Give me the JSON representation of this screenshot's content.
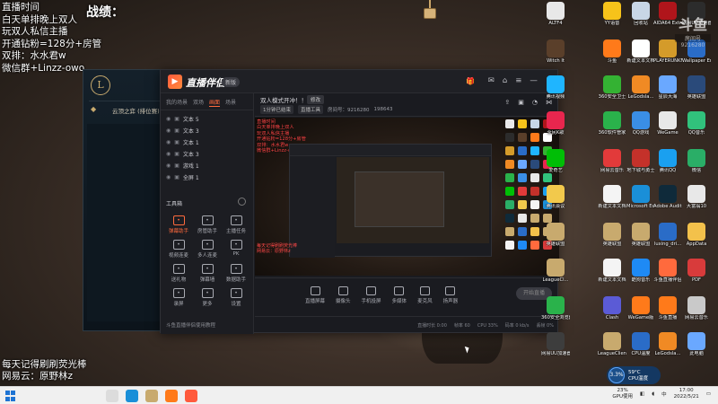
{
  "overlay": {
    "lines": [
      "直播时间",
      "白天单排晚上双人",
      "玩双人私信主播",
      "开通钻粉=128分+房管",
      "双排：水水君w",
      "微信群+Linzz-owo"
    ],
    "score_label": "战绩：",
    "bottom_lines": [
      "每天记得刷刷荧光棒",
      "网易云：原野林z"
    ]
  },
  "game_client": {
    "row_title": "云顶之弈 (排位赛)"
  },
  "app": {
    "name": "直播伴侣",
    "version_badge": "新版",
    "sidebar_tabs": [
      "我的场景",
      "双场",
      "画面",
      "场景"
    ],
    "sources": [
      "文本 5",
      "文本 3",
      "文本 1",
      "文本 3",
      "游戏 1",
      "全屏 1"
    ],
    "tools_title": "工具箱",
    "tools": [
      {
        "label": "弹幕助手",
        "icon": "danmu-icon",
        "hot": true
      },
      {
        "label": "房管助手",
        "icon": "manager-icon",
        "hot": false
      },
      {
        "label": "主播任务",
        "icon": "task-icon",
        "hot": false
      },
      {
        "label": "视频连麦",
        "icon": "video-link-icon",
        "hot": false
      },
      {
        "label": "多人连麦",
        "icon": "multi-link-icon",
        "hot": false
      },
      {
        "label": "PK",
        "icon": "pk-icon",
        "hot": false
      },
      {
        "label": "送礼物",
        "icon": "gift-icon",
        "hot": false
      },
      {
        "label": "弹幕墙",
        "icon": "wall-icon",
        "hot": false
      },
      {
        "label": "数据助手",
        "icon": "data-icon",
        "hot": false
      },
      {
        "label": "录屏",
        "icon": "record-icon",
        "hot": false
      },
      {
        "label": "更多",
        "icon": "more-icon",
        "hot": false
      },
      {
        "label": "设置",
        "icon": "settings-icon",
        "hot": false
      }
    ],
    "side_footer": "斗鱼直播伴侣使用教程",
    "room_title": "双人模式开冲！！",
    "room_button": "修改",
    "room_sub": [
      "1分钟已结束",
      "直播工具",
      "房间号：9216280",
      "198643"
    ],
    "preview_overlay": [
      "直播时间",
      "白天单排晚上双人",
      "玩双人私信主播",
      "开通钻粉=128分+房管",
      "双排：水水君w",
      "微信群+Linzz-owo"
    ],
    "preview_bottom": [
      "每天记得刷刷荧光棒",
      "网易云：原野林z"
    ],
    "controls": [
      {
        "label": "直播屏幕",
        "icon": "screen-icon"
      },
      {
        "label": "摄像头",
        "icon": "camera-icon"
      },
      {
        "label": "手机投屏",
        "icon": "phone-cast-icon"
      },
      {
        "label": "多媒体",
        "icon": "media-icon"
      },
      {
        "label": "麦克风",
        "icon": "mic-icon"
      },
      {
        "label": "扬声器",
        "icon": "speaker-icon"
      }
    ],
    "start_button": "开始直播",
    "status": [
      "直播时长 0:00",
      "帧率 60",
      "CPU 33%",
      "码率 0 kb/s",
      "丢帧 0%"
    ]
  },
  "desktop_icons": [
    {
      "label": "ALTF4",
      "color": "#e8e8e8"
    },
    {
      "label": "YY语音",
      "color": "#f7c31a"
    },
    {
      "label": "回收站",
      "color": "#c8d6e6"
    },
    {
      "label": "AIDA64 Extreme",
      "color": "#b0151b"
    },
    {
      "label": "网易UU加速器",
      "color": "#2c2c2c"
    },
    {
      "label": "Witch It",
      "color": "#5a3f2a"
    },
    {
      "label": "斗鱼",
      "color": "#ff7a1a"
    },
    {
      "label": "新建文本文档",
      "color": "#ffffff"
    },
    {
      "label": "PLAYERUNKNOWN'S BATTLEGROUNDS",
      "color": "#d49b2a"
    },
    {
      "label": "Wallpaper Engine",
      "color": "#2a6cc7"
    },
    {
      "label": "腾讯视频",
      "color": "#1fb5ff"
    },
    {
      "label": "360安全卫士",
      "color": "#34b233"
    },
    {
      "label": "LeGodsla...",
      "color": "#f08a24"
    },
    {
      "label": "星辰大海",
      "color": "#6aa8ff"
    },
    {
      "label": "英雄联盟",
      "color": "#2a4a7a"
    },
    {
      "label": "全民K歌",
      "color": "#e8264e"
    },
    {
      "label": "360软件管家",
      "color": "#2ab24b"
    },
    {
      "label": "QQ游戏",
      "color": "#3a8ee6"
    },
    {
      "label": "WeGame",
      "color": "#e8e8e8"
    },
    {
      "label": "QQ音乐",
      "color": "#31c27c"
    },
    {
      "label": "爱奇艺",
      "color": "#00be06"
    },
    {
      "label": "网易云音乐",
      "color": "#e23a3a"
    },
    {
      "label": "地下城与勇士",
      "color": "#c4312a"
    },
    {
      "label": "腾讯QQ",
      "color": "#1aa0f0"
    },
    {
      "label": "微信",
      "color": "#2aae67"
    },
    {
      "label": "腾讯会议",
      "color": "#f2c94c"
    },
    {
      "label": "新建文本文档",
      "color": "#f4f4f4"
    },
    {
      "label": "Microsoft Edge",
      "color": "#1a8fd8"
    },
    {
      "label": "Adobe Audition",
      "color": "#0f2a3a"
    },
    {
      "label": "大富翁10",
      "color": "#e8e8e8"
    },
    {
      "label": "英雄联盟",
      "color": "#c8aa6e"
    },
    {
      "label": "英雄联盟",
      "color": "#c8aa6e"
    },
    {
      "label": "英雄联盟",
      "color": "#c8aa6e"
    },
    {
      "label": "luxing_dri...",
      "color": "#2a6cc7"
    },
    {
      "label": "AppData",
      "color": "#f3c14b"
    },
    {
      "label": "LeagueCl...",
      "color": "#c8aa6e"
    },
    {
      "label": "新建文本文档",
      "color": "#f4f4f4"
    },
    {
      "label": "酷狗音乐",
      "color": "#1e8af5"
    },
    {
      "label": "斗鱼直播伴侣",
      "color": "#ff6a3d"
    },
    {
      "label": "PDF",
      "color": "#d83b3b"
    },
    {
      "label": "360安全浏览器",
      "color": "#2ab24b"
    },
    {
      "label": "Clash",
      "color": "#5b5bd6"
    },
    {
      "label": "WeGame版",
      "color": "#ff7a1a"
    },
    {
      "label": "斗鱼直播",
      "color": "#ff7a1a"
    },
    {
      "label": "网易云音乐",
      "color": "#c9c9c9"
    },
    {
      "label": "网易UU加速器",
      "color": "#3d3d3d"
    },
    {
      "label": "LeagueClient",
      "color": "#c8aa6e"
    },
    {
      "label": "CPU温度",
      "color": "#2a6cc7"
    },
    {
      "label": "LeGodsla...",
      "color": "#f08a24"
    },
    {
      "label": "此电脑",
      "color": "#6aa8ff"
    }
  ],
  "watermark": {
    "logo": "斗鱼",
    "sub": "房间号",
    "num": "9216280"
  },
  "cpu_widget": {
    "value": "3.3%",
    "line1": "59°C",
    "line2": "CPU温度"
  },
  "taskbar": {
    "apps": [
      {
        "name": "search-app",
        "color": "#dcdcdc"
      },
      {
        "name": "edge-app",
        "color": "#1a8fd8"
      },
      {
        "name": "league-app",
        "color": "#c8aa6e"
      },
      {
        "name": "douyu-app",
        "color": "#ff7a1a"
      },
      {
        "name": "companion-app",
        "color": "#ff5a3c"
      }
    ],
    "gpu_pct": "23%",
    "gpu_label": "GPU使用",
    "time": "17:00",
    "date": "2022/5/21",
    "lang": "中"
  }
}
